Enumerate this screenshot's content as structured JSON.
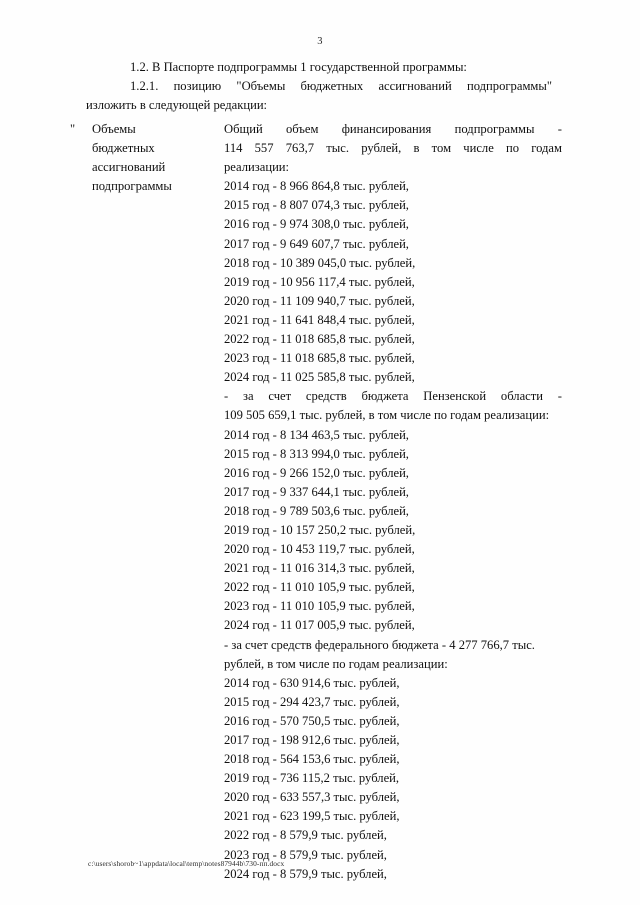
{
  "document": {
    "page_number": "3",
    "footer_path": "c:\\users\\shorob~1\\appdata\\local\\temp\\notes87944b\\730-пп.docx"
  },
  "intro": {
    "clause_1_2": "1.2. В Паспорте подпрограммы 1 государственной программы:",
    "clause_1_2_1": "1.2.1. позицию \"Объемы бюджетных ассигнований подпрограммы\"",
    "clause_1_2_1_cont": "изложить в следующей редакции:"
  },
  "table": {
    "open_quote": "\"",
    "label_lines": [
      "Объемы",
      "бюджетных",
      "ассигнований",
      "подпрограммы"
    ],
    "total": {
      "intro_line_1": "Общий объем финансирования подпрограммы -",
      "intro_line_2": "114 557 763,7 тыс. рублей, в том числе по годам",
      "intro_line_3": "реализации:",
      "years": [
        "2014 год - 8 966 864,8 тыс. рублей,",
        "2015 год - 8 807 074,3 тыс. рублей,",
        "2016 год - 9 974 308,0 тыс. рублей,",
        "2017 год - 9 649 607,7 тыс. рублей,",
        "2018 год - 10 389 045,0 тыс. рублей,",
        "2019 год - 10 956 117,4 тыс. рублей,",
        "2020 год - 11 109 940,7 тыс. рублей,",
        "2021 год - 11 641 848,4 тыс. рублей,",
        "2022 год - 11 018 685,8 тыс. рублей,",
        "2023 год - 11 018 685,8 тыс. рублей,",
        "2024 год - 11 025 585,8 тыс. рублей,"
      ]
    },
    "regional": {
      "intro_line_1": "- за счет средств бюджета Пензенской области -",
      "intro_line_2": "109 505 659,1 тыс. рублей, в том числе по годам реализации:",
      "years": [
        "2014 год - 8 134 463,5 тыс. рублей,",
        "2015 год - 8 313 994,0 тыс. рублей,",
        "2016 год - 9 266 152,0 тыс. рублей,",
        "2017 год - 9 337 644,1 тыс. рублей,",
        "2018 год - 9 789 503,6 тыс. рублей,",
        "2019 год - 10 157 250,2 тыс. рублей,",
        "2020 год - 10 453 119,7 тыс. рублей,",
        "2021 год - 11 016 314,3 тыс. рублей,",
        "2022 год - 11 010 105,9 тыс. рублей,",
        "2023 год - 11 010 105,9 тыс. рублей,",
        "2024 год - 11 017 005,9 тыс. рублей,"
      ]
    },
    "federal": {
      "intro_line_1": "- за счет средств федерального бюджета - 4 277 766,7 тыс.",
      "intro_line_2": "рублей, в том числе по годам реализации:",
      "years": [
        "2014 год - 630 914,6 тыс. рублей,",
        "2015 год - 294 423,7 тыс. рублей,",
        "2016 год - 570 750,5 тыс. рублей,",
        "2017 год - 198 912,6 тыс. рублей,",
        "2018 год - 564 153,6 тыс. рублей,",
        "2019 год - 736 115,2 тыс. рублей,",
        "2020 год - 633 557,3 тыс. рублей,",
        "2021 год - 623 199,5 тыс. рублей,",
        "2022 год - 8 579,9 тыс. рублей,",
        "2023 год - 8 579,9 тыс. рублей,",
        "2024 год - 8 579,9 тыс. рублей,"
      ]
    }
  }
}
